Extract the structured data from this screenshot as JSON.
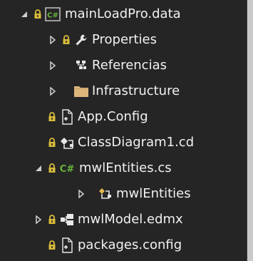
{
  "tree": {
    "items": [
      {
        "label": "mainLoadPro.data",
        "icon": "csharp-project-icon",
        "expanded": true,
        "locked": true
      },
      {
        "label": "Properties",
        "icon": "wrench-icon",
        "expanded": false,
        "locked": true
      },
      {
        "label": "Referencias",
        "icon": "references-icon",
        "expanded": false,
        "locked": false
      },
      {
        "label": "Infrastructure",
        "icon": "folder-icon",
        "expanded": false,
        "locked": false
      },
      {
        "label": "App.Config",
        "icon": "config-file-icon",
        "locked": true
      },
      {
        "label": "ClassDiagram1.cd",
        "icon": "class-diagram-icon",
        "locked": true
      },
      {
        "label": "mwlEntities.cs",
        "icon": "csharp-file-icon",
        "expanded": true,
        "locked": true
      },
      {
        "label": "mwlEntities",
        "icon": "class-icon",
        "expanded": false,
        "locked": false
      },
      {
        "label": "mwlModel.edmx",
        "icon": "edmx-icon",
        "expanded": false,
        "locked": true
      },
      {
        "label": "packages.config",
        "icon": "config-file-icon",
        "locked": true
      }
    ]
  },
  "colors": {
    "background": "#252526",
    "text": "#f1f1f1",
    "lock": "#d7ba3a",
    "folder": "#dcb67a",
    "csharp": "#68b43c"
  }
}
